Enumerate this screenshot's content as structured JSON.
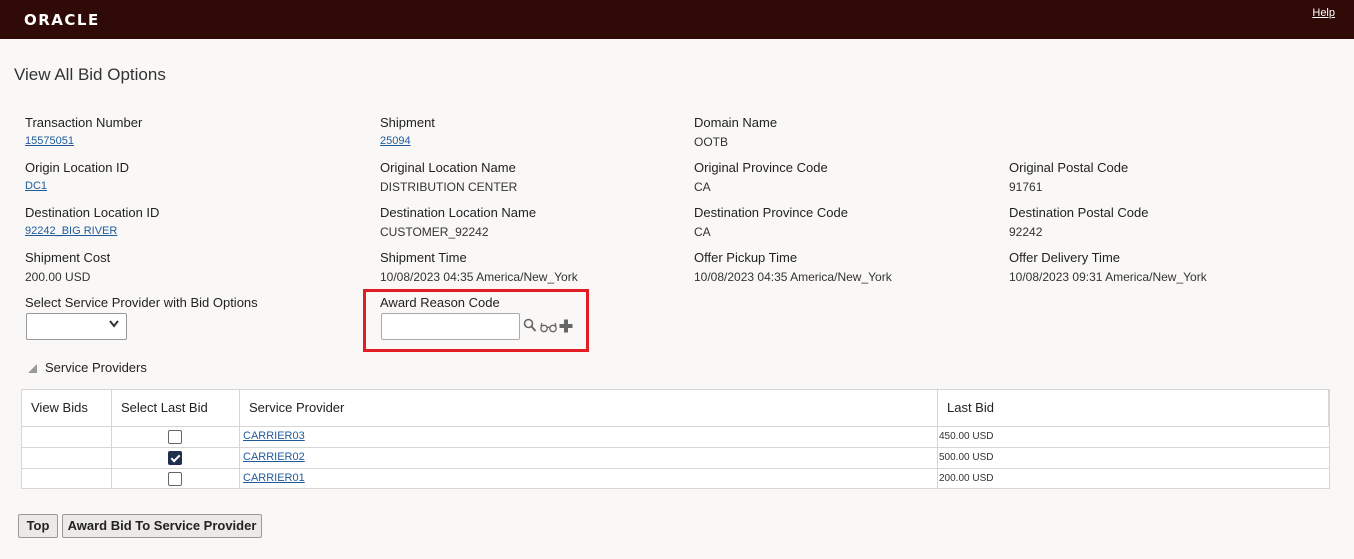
{
  "header": {
    "logo": "ORACLE",
    "help": "Help"
  },
  "page": {
    "title": "View All Bid Options"
  },
  "fields": {
    "transaction_number": {
      "label": "Transaction Number",
      "value": "15575051"
    },
    "shipment": {
      "label": "Shipment",
      "value": "25094"
    },
    "domain_name": {
      "label": "Domain Name",
      "value": "OOTB"
    },
    "origin_location_id": {
      "label": "Origin Location ID",
      "value": "DC1"
    },
    "original_location_name": {
      "label": "Original Location Name",
      "value": "DISTRIBUTION CENTER"
    },
    "original_province_code": {
      "label": "Original Province Code",
      "value": "CA"
    },
    "original_postal_code": {
      "label": "Original Postal Code",
      "value": "91761"
    },
    "destination_location_id": {
      "label": "Destination Location ID",
      "value": "92242_BIG RIVER"
    },
    "destination_location_name": {
      "label": "Destination Location Name",
      "value": "CUSTOMER_92242"
    },
    "destination_province_code": {
      "label": "Destination Province Code",
      "value": "CA"
    },
    "destination_postal_code": {
      "label": "Destination Postal Code",
      "value": "92242"
    },
    "shipment_cost": {
      "label": "Shipment Cost",
      "value": "200.00 USD"
    },
    "shipment_time": {
      "label": "Shipment Time",
      "value": "10/08/2023 04:35 America/New_York"
    },
    "offer_pickup_time": {
      "label": "Offer Pickup Time",
      "value": "10/08/2023 04:35 America/New_York"
    },
    "offer_delivery_time": {
      "label": "Offer Delivery Time",
      "value": "10/08/2023 09:31 America/New_York"
    },
    "select_service_provider": {
      "label": "Select Service Provider with Bid Options",
      "value": ""
    },
    "award_reason_code": {
      "label": "Award Reason Code",
      "value": ""
    }
  },
  "icons": {
    "award_reason_code": [
      "search-icon",
      "view-glasses-icon",
      "add-plus-icon"
    ],
    "dropdown": "chevron-down-icon",
    "section": "collapse-triangle-icon"
  },
  "section": {
    "title": "Service Providers"
  },
  "table": {
    "columns": [
      "View Bids",
      "Select Last Bid",
      "Service Provider",
      "Last Bid"
    ],
    "rows": [
      {
        "view_bids": "",
        "select_last_bid": false,
        "service_provider": "CARRIER03",
        "last_bid": "450.00 USD"
      },
      {
        "view_bids": "",
        "select_last_bid": true,
        "service_provider": "CARRIER02",
        "last_bid": "500.00 USD"
      },
      {
        "view_bids": "",
        "select_last_bid": false,
        "service_provider": "CARRIER01",
        "last_bid": "200.00 USD"
      }
    ]
  },
  "buttons": {
    "top": "Top",
    "award": "Award Bid To Service Provider"
  },
  "colors": {
    "header_bg": "#300a06",
    "link": "#1f5b9b",
    "highlight": "#e01d24",
    "checkbox_checked": "#1d2f4a"
  }
}
